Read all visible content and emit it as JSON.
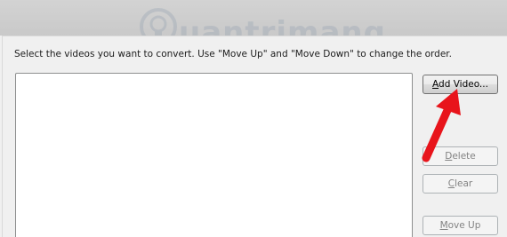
{
  "watermark": {
    "text": "uantrimang",
    "color": "#9aa6b4"
  },
  "dialog": {
    "instruction": "Select the videos you want to convert. Use \"Move Up\" and \"Move Down\" to change the order."
  },
  "buttons": {
    "add_video": {
      "accesskey": "A",
      "rest": "dd Video...",
      "enabled": true
    },
    "delete": {
      "accesskey": "D",
      "rest": "elete",
      "enabled": false
    },
    "clear": {
      "accesskey": "C",
      "rest": "lear",
      "enabled": false
    },
    "move_up": {
      "accesskey": "M",
      "rest": "ove Up",
      "enabled": false
    }
  },
  "annotation": {
    "arrow_color": "#e8141b",
    "arrow_icon": "red-arrow-annotation"
  }
}
